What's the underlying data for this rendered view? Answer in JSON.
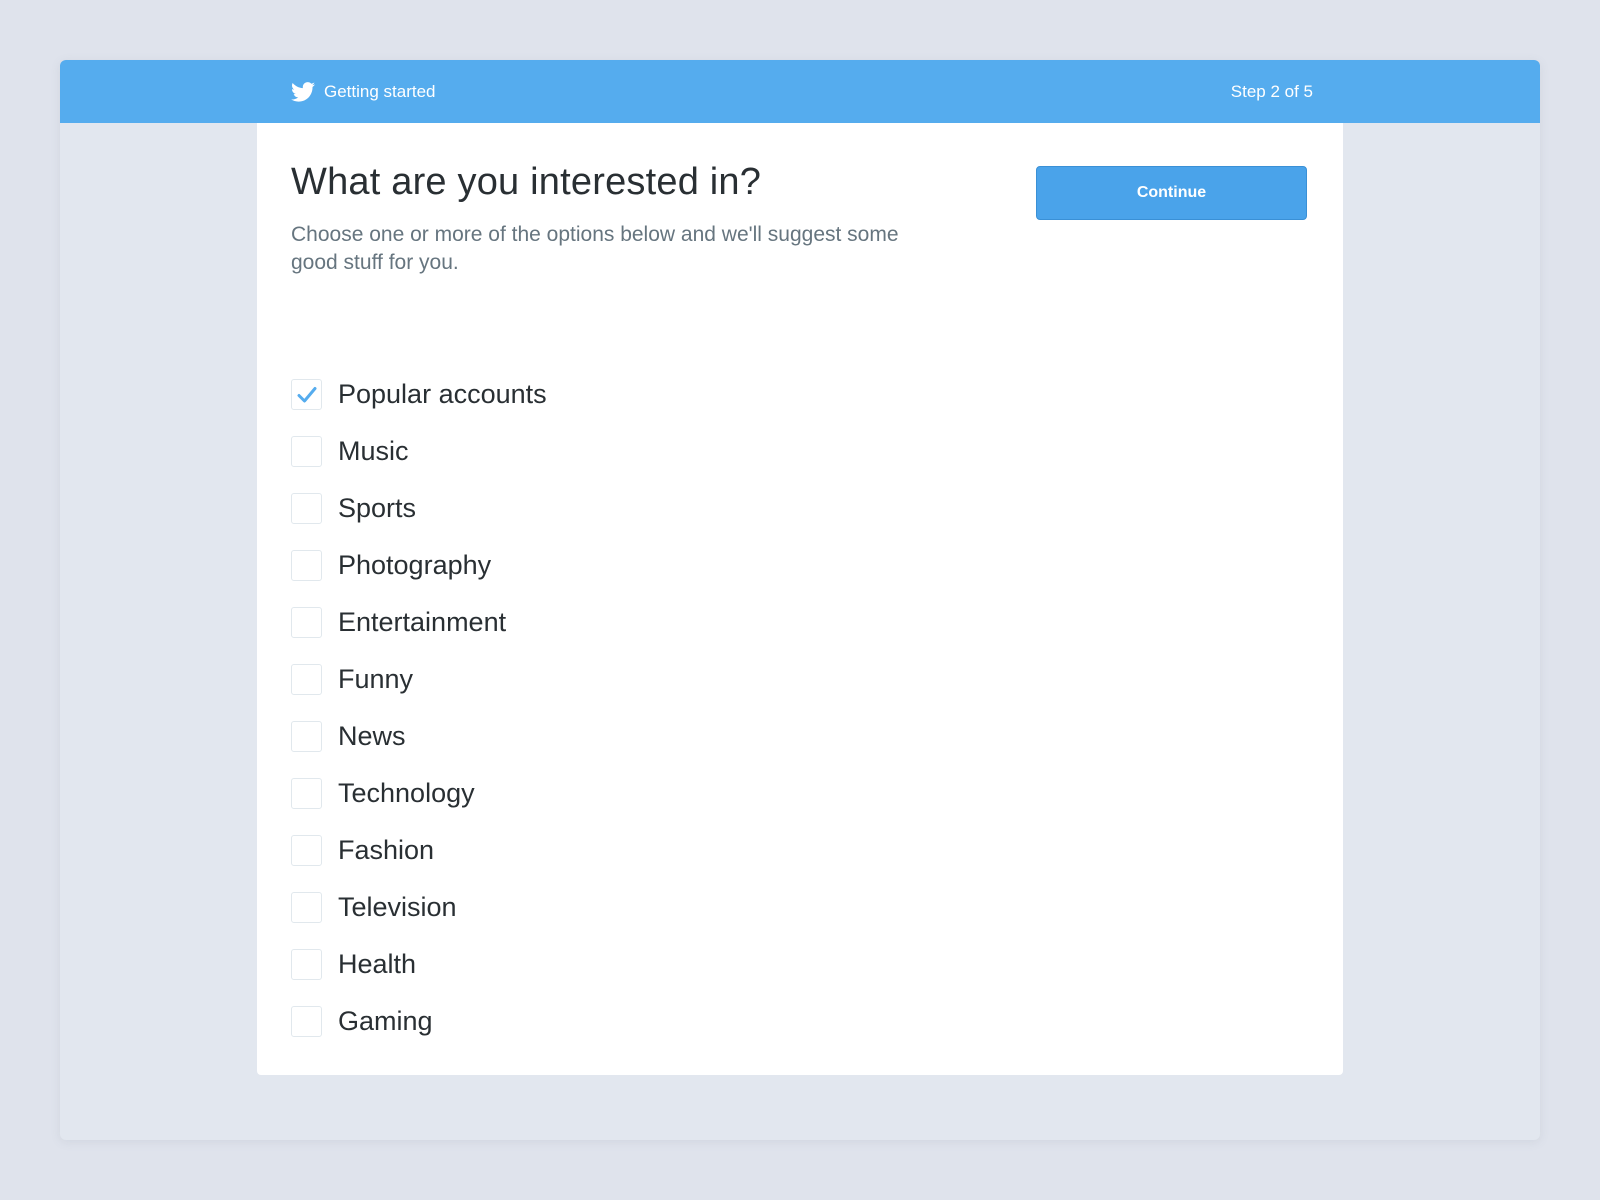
{
  "header": {
    "brand_icon": "twitter-bird-icon",
    "title": "Getting started",
    "step": "Step 2 of 5"
  },
  "main": {
    "heading": "What are you interested in?",
    "subtitle": "Choose one or more of the options below and we'll suggest some good stuff for you.",
    "continue_label": "Continue"
  },
  "interests": [
    {
      "label": "Popular accounts",
      "checked": true
    },
    {
      "label": "Music",
      "checked": false
    },
    {
      "label": "Sports",
      "checked": false
    },
    {
      "label": "Photography",
      "checked": false
    },
    {
      "label": "Entertainment",
      "checked": false
    },
    {
      "label": "Funny",
      "checked": false
    },
    {
      "label": "News",
      "checked": false
    },
    {
      "label": "Technology",
      "checked": false
    },
    {
      "label": "Fashion",
      "checked": false
    },
    {
      "label": "Television",
      "checked": false
    },
    {
      "label": "Health",
      "checked": false
    },
    {
      "label": "Gaming",
      "checked": false
    }
  ],
  "colors": {
    "brand": "#55acee",
    "button": "#4aa3ea",
    "check": "#55acee"
  }
}
